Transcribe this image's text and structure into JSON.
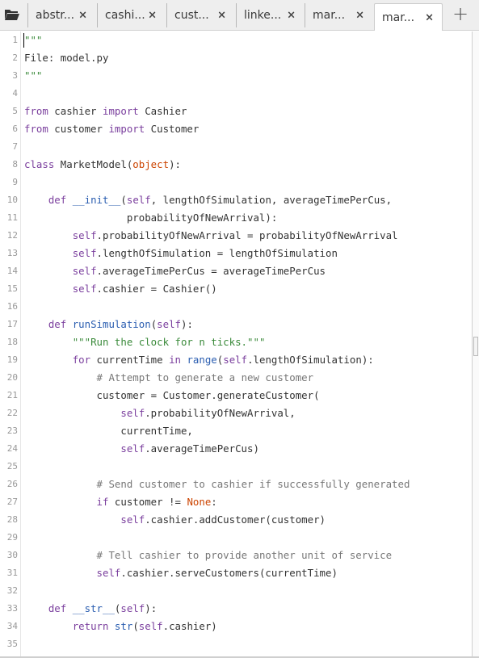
{
  "tabs": [
    {
      "label": "abstr...",
      "close": "×"
    },
    {
      "label": "cashi...",
      "close": "×"
    },
    {
      "label": "cust...",
      "close": "×"
    },
    {
      "label": "linke...",
      "close": "×"
    },
    {
      "label": "mar...",
      "close": "×"
    },
    {
      "label": "mar...",
      "close": "×"
    }
  ],
  "new_tab_label": "+",
  "icons": {
    "open_folder": "folder-open-icon",
    "close": "close-icon",
    "add": "plus-icon"
  },
  "active_tab_index": 5,
  "code_lines": [
    {
      "n": "1",
      "text": "\"\"\""
    },
    {
      "n": "2",
      "text": "File: model.py"
    },
    {
      "n": "3",
      "text": "\"\"\""
    },
    {
      "n": "4",
      "text": ""
    },
    {
      "n": "5",
      "text": "from cashier import Cashier"
    },
    {
      "n": "6",
      "text": "from customer import Customer"
    },
    {
      "n": "7",
      "text": ""
    },
    {
      "n": "8",
      "text": "class MarketModel(object):"
    },
    {
      "n": "9",
      "text": ""
    },
    {
      "n": "10",
      "text": "    def __init__(self, lengthOfSimulation, averageTimePerCus,"
    },
    {
      "n": "11",
      "text": "                 probabilityOfNewArrival):"
    },
    {
      "n": "12",
      "text": "        self.probabilityOfNewArrival = probabilityOfNewArrival"
    },
    {
      "n": "13",
      "text": "        self.lengthOfSimulation = lengthOfSimulation"
    },
    {
      "n": "14",
      "text": "        self.averageTimePerCus = averageTimePerCus"
    },
    {
      "n": "15",
      "text": "        self.cashier = Cashier()"
    },
    {
      "n": "16",
      "text": ""
    },
    {
      "n": "17",
      "text": "    def runSimulation(self):"
    },
    {
      "n": "18",
      "text": "        \"\"\"Run the clock for n ticks.\"\"\""
    },
    {
      "n": "19",
      "text": "        for currentTime in range(self.lengthOfSimulation):"
    },
    {
      "n": "20",
      "text": "            # Attempt to generate a new customer"
    },
    {
      "n": "21",
      "text": "            customer = Customer.generateCustomer("
    },
    {
      "n": "22",
      "text": "                self.probabilityOfNewArrival,"
    },
    {
      "n": "23",
      "text": "                currentTime,"
    },
    {
      "n": "24",
      "text": "                self.averageTimePerCus)"
    },
    {
      "n": "25",
      "text": ""
    },
    {
      "n": "26",
      "text": "            # Send customer to cashier if successfully generated"
    },
    {
      "n": "27",
      "text": "            if customer != None:"
    },
    {
      "n": "28",
      "text": "                self.cashier.addCustomer(customer)"
    },
    {
      "n": "29",
      "text": ""
    },
    {
      "n": "30",
      "text": "            # Tell cashier to provide another unit of service"
    },
    {
      "n": "31",
      "text": "            self.cashier.serveCustomers(currentTime)"
    },
    {
      "n": "32",
      "text": ""
    },
    {
      "n": "33",
      "text": "    def __str__(self):"
    },
    {
      "n": "34",
      "text": "        return str(self.cashier)"
    },
    {
      "n": "35",
      "text": ""
    }
  ],
  "colors": {
    "keyword": "#7a3e9d",
    "function": "#2a5db0",
    "string": "#3a8a3a",
    "comment": "#777777",
    "builtin_param": "#cc4400"
  }
}
